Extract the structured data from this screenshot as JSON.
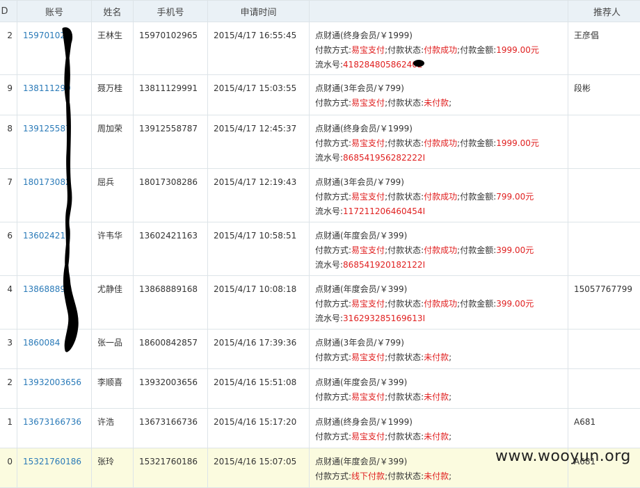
{
  "headers": {
    "idx": "D",
    "account": "账号",
    "name": "姓名",
    "phone": "手机号",
    "time": "申请时间",
    "detail": "",
    "referrer": "推荐人"
  },
  "labels": {
    "pay_method": "付款方式:",
    "pay_status": ";付款状态:",
    "pay_amount": ";付款金额:",
    "serial": "流水号:",
    "trail": ";"
  },
  "rows": [
    {
      "idx": "2",
      "account": "159701029",
      "name": "王林生",
      "phone": "15970102965",
      "time": "2015/4/17 16:55:45",
      "product": "点财通(终身会员/￥1999)",
      "method": "易宝支付",
      "status": "付款成功",
      "amount": "1999.00元",
      "serial": "418284805862402",
      "referrer": "王彦倡"
    },
    {
      "idx": "9",
      "account": "138111299",
      "name": "聂万桂",
      "phone": "13811129991",
      "time": "2015/4/17 15:03:55",
      "product": "点财通(3年会员/￥799)",
      "method": "易宝支付",
      "status": "未付款",
      "amount": "",
      "serial": "",
      "referrer": "段彬"
    },
    {
      "idx": "8",
      "account": "139125587",
      "name": "周加荣",
      "phone": "13912558787",
      "time": "2015/4/17 12:45:37",
      "product": "点财通(终身会员/￥1999)",
      "method": "易宝支付",
      "status": "付款成功",
      "amount": "1999.00元",
      "serial": "868541956282222I",
      "referrer": ""
    },
    {
      "idx": "7",
      "account": "180173082",
      "name": "屈兵",
      "phone": "18017308286",
      "time": "2015/4/17 12:19:43",
      "product": "点财通(3年会员/￥799)",
      "method": "易宝支付",
      "status": "付款成功",
      "amount": "799.00元",
      "serial": "117211206460454I",
      "referrer": ""
    },
    {
      "idx": "6",
      "account": "136024211",
      "name": "许韦华",
      "phone": "13602421163",
      "time": "2015/4/17 10:58:51",
      "product": "点财通(年度会员/￥399)",
      "method": "易宝支付",
      "status": "付款成功",
      "amount": "399.00元",
      "serial": "868541920182122I",
      "referrer": ""
    },
    {
      "idx": "4",
      "account": "138688898",
      "name": "尤静佳",
      "phone": "13868889168",
      "time": "2015/4/17 10:08:18",
      "product": "点财通(年度会员/￥399)",
      "method": "易宝支付",
      "status": "付款成功",
      "amount": "399.00元",
      "serial": "316293285169613I",
      "referrer": "15057767799"
    },
    {
      "idx": "3",
      "account": "1860084",
      "name": "张一品",
      "phone": "18600842857",
      "time": "2015/4/16 17:39:36",
      "product": "点财通(3年会员/￥799)",
      "method": "易宝支付",
      "status": "未付款",
      "amount": "",
      "serial": "",
      "referrer": ""
    },
    {
      "idx": "2",
      "account": "13932003656",
      "name": "李顺喜",
      "phone": "13932003656",
      "time": "2015/4/16 15:51:08",
      "product": "点财通(年度会员/￥399)",
      "method": "易宝支付",
      "status": "未付款",
      "amount": "",
      "serial": "",
      "referrer": ""
    },
    {
      "idx": "1",
      "account": "13673166736",
      "name": "许浩",
      "phone": "13673166736",
      "time": "2015/4/16 15:17:20",
      "product": "点财通(终身会员/￥1999)",
      "method": "易宝支付",
      "status": "未付款",
      "amount": "",
      "serial": "",
      "referrer": "A681"
    },
    {
      "idx": "0",
      "account": "15321760186",
      "name": "张玲",
      "phone": "15321760186",
      "time": "2015/4/16 15:07:05",
      "product": "点财通(年度会员/￥399)",
      "method": "线下付款",
      "status": "未付款",
      "amount": "",
      "serial": "",
      "referrer": "A681"
    }
  ],
  "watermark": "www.wooyun.org",
  "colors": {
    "link": "#2a7ab8",
    "accent_red": "#e02020",
    "header_bg": "#eaf1f6",
    "highlight_row": "#fbfbdf"
  }
}
